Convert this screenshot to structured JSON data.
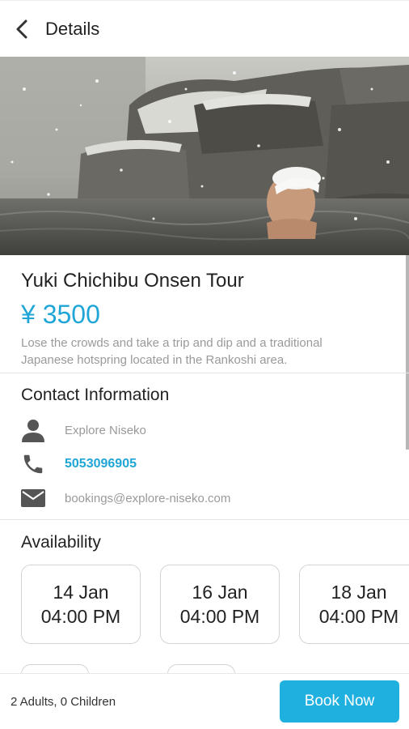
{
  "header": {
    "title": "Details"
  },
  "tour": {
    "title": "Yuki Chichibu Onsen Tour",
    "price": "¥ 3500",
    "description": "Lose the crowds and take a trip and dip and a traditional Japanese hotspring located in the Rankoshi area."
  },
  "contact": {
    "section_title": "Contact Information",
    "name": "Explore Niseko",
    "phone": "5053096905",
    "email": "bookings@explore-niseko.com"
  },
  "availability": {
    "section_title": "Availability",
    "slots": [
      {
        "date": "14 Jan",
        "time": "04:00 PM"
      },
      {
        "date": "16 Jan",
        "time": "04:00 PM"
      },
      {
        "date": "18 Jan",
        "time": "04:00 PM"
      }
    ]
  },
  "footer": {
    "guests": "2 Adults, 0 Children",
    "book_label": "Book Now"
  },
  "colors": {
    "accent": "#1fa6d6",
    "button": "#1fb0e0"
  }
}
